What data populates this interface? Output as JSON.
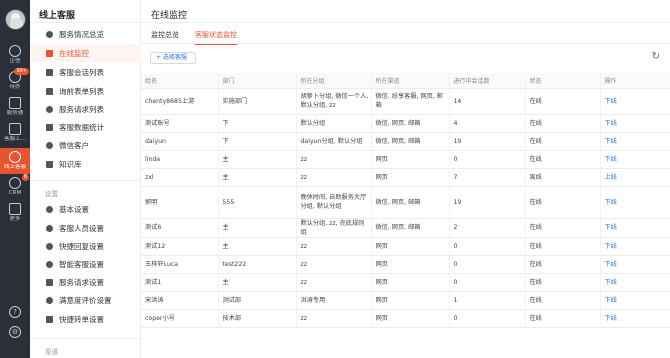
{
  "rail": {
    "items": [
      {
        "label": "企信",
        "badge": ""
      },
      {
        "label": "待办",
        "badge": "99+"
      },
      {
        "label": "服务通",
        "badge": ""
      },
      {
        "label": "客服工...",
        "badge": ""
      },
      {
        "label": "线上客服",
        "badge": ""
      },
      {
        "label": "CRM",
        "badge": "8"
      },
      {
        "label": "更多",
        "badge": ""
      }
    ],
    "bottom_icons": [
      "help-icon",
      "settings-icon"
    ]
  },
  "menu": {
    "title": "线上客服",
    "items": [
      {
        "label": "服务情况总览",
        "icon": "dashboard-icon"
      },
      {
        "label": "在线监控",
        "icon": "monitor-icon"
      },
      {
        "label": "客服会话列表",
        "icon": "chat-icon"
      },
      {
        "label": "询前表单列表",
        "icon": "form-icon"
      },
      {
        "label": "服务请求列表",
        "icon": "list-icon"
      },
      {
        "label": "客服数据统计",
        "icon": "chart-icon"
      },
      {
        "label": "微信客户",
        "icon": "wechat-icon"
      },
      {
        "label": "知识库",
        "icon": "book-icon"
      }
    ],
    "settings_group": "设置",
    "settings": [
      {
        "label": "基本设置",
        "icon": "gear-icon"
      },
      {
        "label": "客服人员设置",
        "icon": "user-icon"
      },
      {
        "label": "快捷回复设置",
        "icon": "reply-icon"
      },
      {
        "label": "智能客服设置",
        "icon": "robot-icon"
      },
      {
        "label": "服务请求设置",
        "icon": "request-icon"
      },
      {
        "label": "满意度评价设置",
        "icon": "star-icon"
      },
      {
        "label": "快捷转单设置",
        "icon": "transfer-icon"
      }
    ],
    "channel_group": "渠道"
  },
  "main": {
    "title": "在线监控",
    "tabs": [
      "监控总览",
      "客服状态监控"
    ],
    "select_button": "+ 选择客服",
    "table": {
      "headers": [
        "姓名",
        "部门",
        "所在分组",
        "所在渠道",
        "进行中会话数",
        "状态",
        "操作"
      ],
      "rows": [
        [
          "chenty8685上游",
          "实施部门",
          "胡萝卜分组, 微信一个人, 默认分组, zz",
          "微信, 纷享客服, 网页, 邮箱",
          "14",
          "在线",
          "下线"
        ],
        [
          "测试账号",
          "下",
          "默认分组",
          "微信, 网页, 邮箱",
          "4",
          "在线",
          "下线"
        ],
        [
          "daiyun",
          "下",
          "daiyun分组, 默认分组",
          "微信, 网页, 邮箱",
          "19",
          "在线",
          "下线"
        ],
        [
          "linda",
          "主",
          "zz",
          "网页",
          "0",
          "在线",
          "下线"
        ],
        [
          "zxl",
          "主",
          "zz",
          "网页",
          "7",
          "离线",
          "上线"
        ],
        [
          "郭明",
          "555",
          "晚休时间, 自助服务大厅分组, 默认分组",
          "微信, 网页, 邮箱",
          "19",
          "在线",
          "下线"
        ],
        [
          "测试6",
          "主",
          "默认分组, zz, 売底规则组",
          "微信, 网页, 邮箱",
          "2",
          "在线",
          "下线"
        ],
        [
          "测试12",
          "主",
          "zz",
          "网页",
          "0",
          "在线",
          "下线"
        ],
        [
          "王梓轩Luca",
          "test222",
          "zz",
          "网页",
          "0",
          "在线",
          "下线"
        ],
        [
          "测试1",
          "主",
          "zz",
          "网页",
          "0",
          "在线",
          "下线"
        ],
        [
          "宋洪涛",
          "测试部",
          "洪涛专用",
          "网页",
          "1",
          "在线",
          "下线"
        ],
        [
          "coper小号",
          "技术部",
          "zz",
          "网页",
          "0",
          "在线",
          "下线"
        ]
      ]
    }
  },
  "colors": {
    "accent": "#e8542d",
    "link": "#1e7ae6",
    "rail": "#2b2f3a"
  }
}
